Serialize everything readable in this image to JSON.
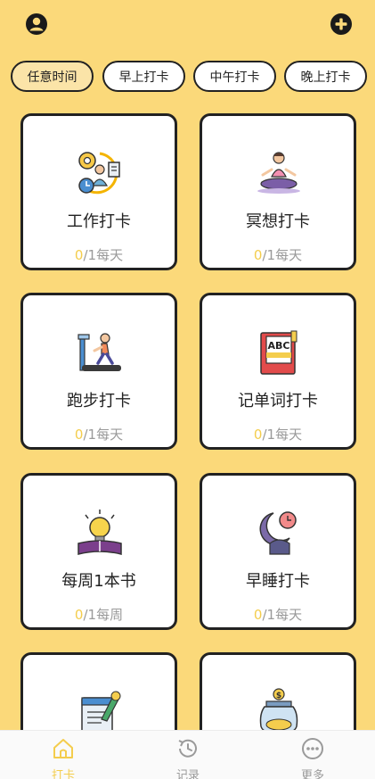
{
  "header": {
    "profile_icon": "user-circle-icon",
    "add_icon": "plus-circle-icon"
  },
  "filters": [
    {
      "label": "任意时间",
      "active": true
    },
    {
      "label": "早上打卡",
      "active": false
    },
    {
      "label": "中午打卡",
      "active": false
    },
    {
      "label": "晚上打卡",
      "active": false
    }
  ],
  "cards": [
    {
      "title": "工作打卡",
      "done": "0",
      "goal": "/1每天",
      "icon": "work-time-icon"
    },
    {
      "title": "冥想打卡",
      "done": "0",
      "goal": "/1每天",
      "icon": "meditation-icon"
    },
    {
      "title": "跑步打卡",
      "done": "0",
      "goal": "/1每天",
      "icon": "treadmill-icon"
    },
    {
      "title": "记单词打卡",
      "done": "0",
      "goal": "/1每天",
      "icon": "abc-book-icon"
    },
    {
      "title": "每周1本书",
      "done": "0",
      "goal": "/1每周",
      "icon": "lightbulb-book-icon"
    },
    {
      "title": "早睡打卡",
      "done": "0",
      "goal": "/1每天",
      "icon": "moon-clock-icon"
    },
    {
      "title": "",
      "done": "",
      "goal": "",
      "icon": "notebook-pencil-icon"
    },
    {
      "title": "",
      "done": "",
      "goal": "",
      "icon": "coin-jar-icon"
    }
  ],
  "tabbar": {
    "items": [
      {
        "label": "打卡",
        "icon": "home-icon",
        "active": true
      },
      {
        "label": "记录",
        "icon": "history-icon",
        "active": false
      },
      {
        "label": "更多",
        "icon": "more-dots-icon",
        "active": false
      }
    ]
  },
  "colors": {
    "background": "#fbd97a",
    "accent": "#f4cd4d",
    "border": "#222222",
    "muted": "#9a9a9a"
  }
}
